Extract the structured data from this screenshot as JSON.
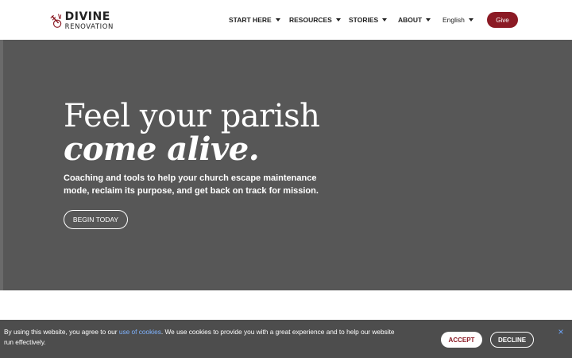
{
  "logo": {
    "line1": "DIVINE",
    "line2": "RENOVATION"
  },
  "nav": {
    "items": [
      {
        "label": "START HERE"
      },
      {
        "label": "RESOURCES"
      },
      {
        "label": "STORIES"
      },
      {
        "label": "ABOUT"
      },
      {
        "label": "English"
      }
    ],
    "give_label": "Give"
  },
  "hero": {
    "title_line1": "Feel your parish",
    "title_line2": "come alive.",
    "subtitle": "Coaching and tools to help your church escape maintenance mode, reclaim its purpose, and get back on track for mission.",
    "cta_label": "BEGIN TODAY"
  },
  "cookie": {
    "text_before": "By using this website, you agree to our ",
    "link_text": "use of cookies",
    "text_after": ". We use cookies to provide you with a great experience and to help our website run effectively.",
    "accept_label": "ACCEPT",
    "decline_label": "DECLINE",
    "close_glyph": "×"
  },
  "colors": {
    "brand": "#8b1a24",
    "hero_bg": "#575757",
    "banner_bg": "#4d4d4d",
    "link": "#7fb3ff"
  }
}
